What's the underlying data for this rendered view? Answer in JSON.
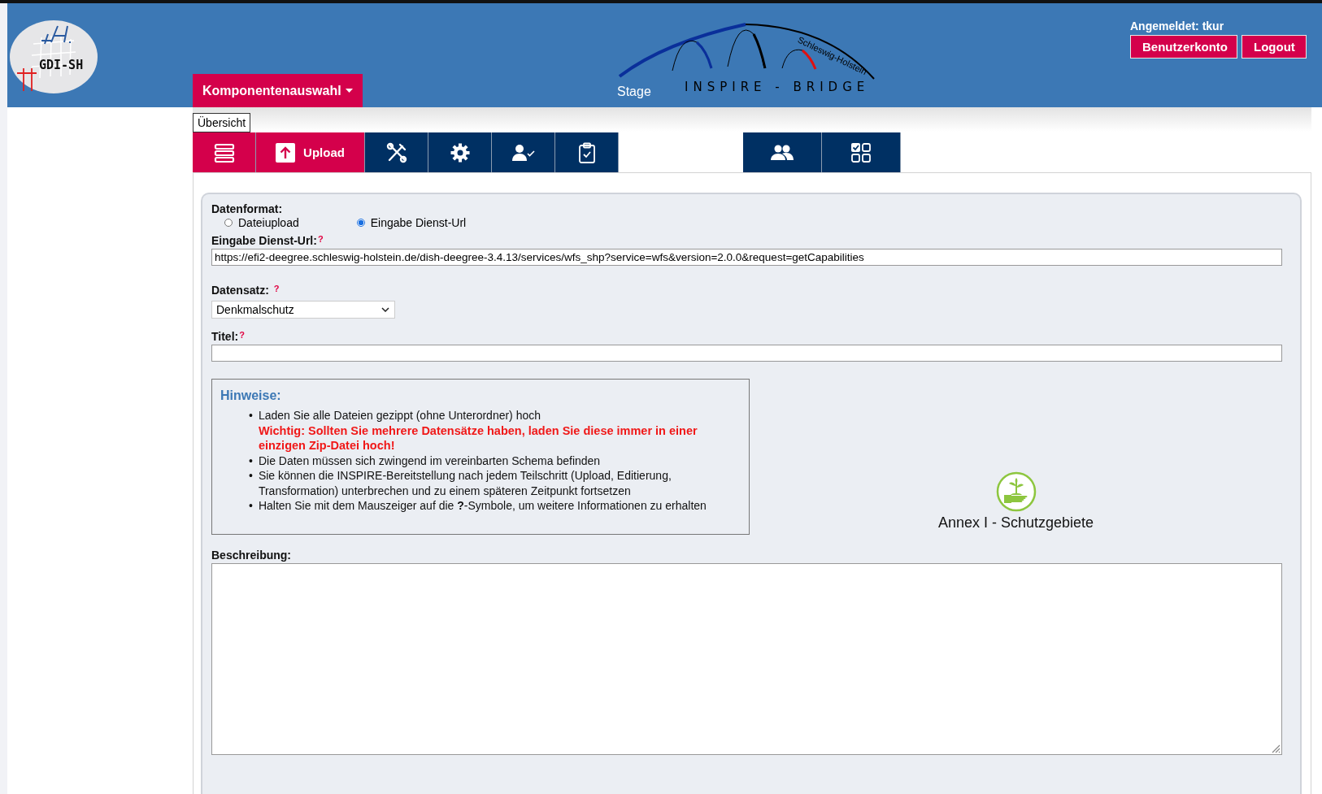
{
  "header": {
    "logo_text": "GDI-SH",
    "component_menu": "Komponentenauswahl",
    "environment": "Stage",
    "brand_arc_text": "Schleswig-Holstein",
    "brand_name": "INSPIRE - BRIDGE",
    "user_label": "Angemeldet: tkur",
    "buttons": [
      "Benutzerkonto",
      "Logout"
    ]
  },
  "tooltip": "Übersicht",
  "tabs": [
    {
      "kind": "overview",
      "selected": true
    },
    {
      "kind": "upload",
      "label": "Upload",
      "selected": true
    },
    {
      "kind": "tools",
      "selected": false
    },
    {
      "kind": "settings",
      "selected": false
    },
    {
      "kind": "user-check",
      "selected": false
    },
    {
      "kind": "clipboard",
      "selected": false
    }
  ],
  "tabs_right": [
    {
      "kind": "users",
      "selected": false
    },
    {
      "kind": "grid",
      "selected": false
    }
  ],
  "data_format": {
    "label": "Datenformat:",
    "options": [
      {
        "label": "Dateiupload",
        "selected": false
      },
      {
        "label": "Eingabe Dienst-Url",
        "selected": true
      }
    ]
  },
  "fields": [
    {
      "kind": "text",
      "label": "Eingabe Dienst-Url:",
      "help_mark": "?",
      "value": "https://efi2-deegree.schleswig-holstein.de/dish-deegree-3.4.13/services/wfs_shp?service=wfs&version=2.0.0&request=getCapabilities"
    },
    {
      "kind": "select",
      "label": "Datensatz:",
      "help_mark": "?",
      "value": "Denkmalschutz"
    },
    {
      "kind": "text",
      "label": "Titel:",
      "help_mark": "?"
    }
  ],
  "notes": {
    "title": "Hinweise:",
    "items": [
      {
        "marker": "•",
        "text": "Laden Sie alle Dateien gezippt (ohne Unterordner) hoch",
        "warning": "Wichtig: Sollten Sie mehrere Datensätze haben, laden Sie diese immer in einer einzigen Zip-Datei hoch!"
      },
      {
        "marker": "•",
        "text": "Die Daten müssen sich zwingend im vereinbarten Schema befinden"
      },
      {
        "marker": "•",
        "text": "Sie können die INSPIRE-Bereitstellung nach jedem Teilschritt (Upload, Editierung, Transformation) unterbrechen und zu einem späteren Zeitpunkt fortsetzen"
      },
      {
        "marker": "•",
        "text": "Halten Sie mit dem Mauszeiger auf die **?**-Symbole, um weitere Informationen zu erhalten"
      }
    ]
  },
  "theme": {
    "label": "Annex I - Schutzgebiete"
  },
  "description": {
    "label": "Beschreibung:"
  }
}
